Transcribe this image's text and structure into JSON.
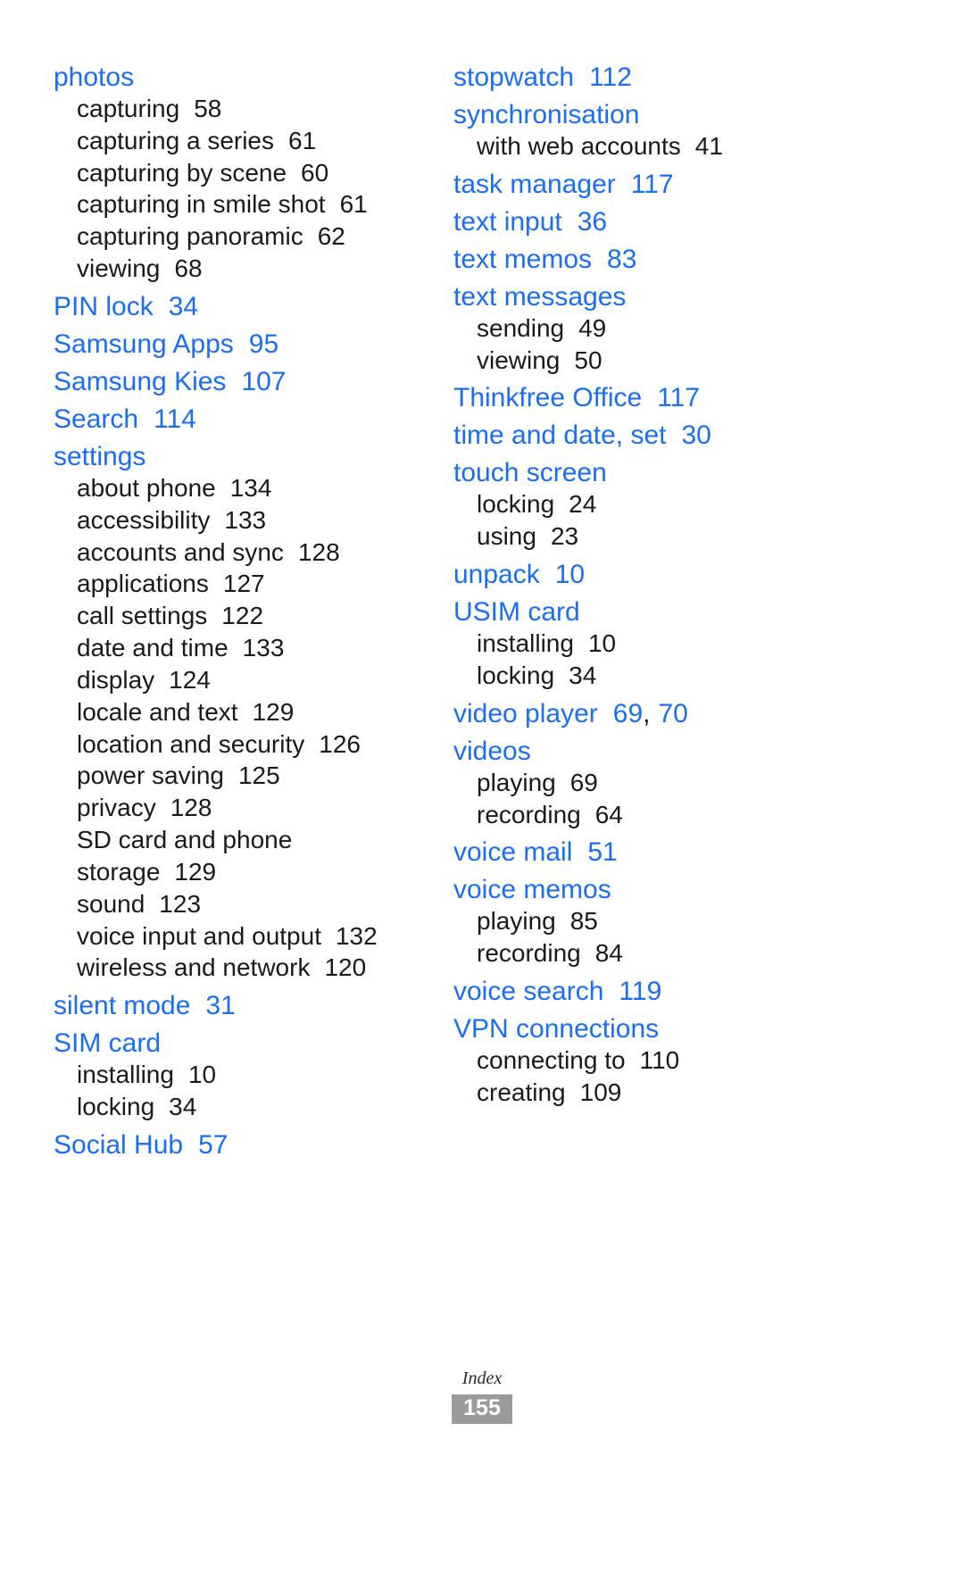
{
  "document": {
    "footer_label": "Index",
    "page_number": "155",
    "accent_color": "#1a6ef5",
    "text_color": "#1a1a1a",
    "badge_color": "#9a9a9a"
  },
  "left_column": [
    {
      "term": "photos",
      "page": "",
      "subs": [
        {
          "label": "capturing",
          "page": "58"
        },
        {
          "label": "capturing a series",
          "page": "61"
        },
        {
          "label": "capturing by scene",
          "page": "60"
        },
        {
          "label": "capturing in smile shot",
          "page": "61"
        },
        {
          "label": "capturing panoramic",
          "page": "62"
        },
        {
          "label": "viewing",
          "page": "68"
        }
      ]
    },
    {
      "term": "PIN lock",
      "page": "34",
      "subs": []
    },
    {
      "term": "Samsung Apps",
      "page": "95",
      "subs": []
    },
    {
      "term": "Samsung Kies",
      "page": "107",
      "subs": []
    },
    {
      "term": "Search",
      "page": "114",
      "subs": []
    },
    {
      "term": "settings",
      "page": "",
      "subs": [
        {
          "label": "about phone",
          "page": "134"
        },
        {
          "label": "accessibility",
          "page": "133"
        },
        {
          "label": "accounts and sync",
          "page": "128"
        },
        {
          "label": "applications",
          "page": "127"
        },
        {
          "label": "call settings",
          "page": "122"
        },
        {
          "label": "date and time",
          "page": "133"
        },
        {
          "label": "display",
          "page": "124"
        },
        {
          "label": "locale and text",
          "page": "129"
        },
        {
          "label": "location and security",
          "page": "126"
        },
        {
          "label": "power saving",
          "page": "125"
        },
        {
          "label": "privacy",
          "page": "128"
        },
        {
          "label": "SD card and phone storage",
          "page": "129",
          "wrap": true
        },
        {
          "label": "sound",
          "page": "123"
        },
        {
          "label": "voice input and output",
          "page": "132"
        },
        {
          "label": "wireless and network",
          "page": "120"
        }
      ]
    },
    {
      "term": "silent mode",
      "page": "31",
      "subs": []
    },
    {
      "term": "SIM card",
      "page": "",
      "subs": [
        {
          "label": "installing",
          "page": "10"
        },
        {
          "label": "locking",
          "page": "34"
        }
      ]
    },
    {
      "term": "Social Hub",
      "page": "57",
      "subs": []
    }
  ],
  "right_column": [
    {
      "term": "stopwatch",
      "page": "112",
      "subs": []
    },
    {
      "term": "synchronisation",
      "page": "",
      "subs": [
        {
          "label": "with web accounts",
          "page": "41"
        }
      ]
    },
    {
      "term": "task manager",
      "page": "117",
      "subs": []
    },
    {
      "term": "text input",
      "page": "36",
      "subs": []
    },
    {
      "term": "text memos",
      "page": "83",
      "subs": []
    },
    {
      "term": "text messages",
      "page": "",
      "subs": [
        {
          "label": "sending",
          "page": "49"
        },
        {
          "label": "viewing",
          "page": "50"
        }
      ]
    },
    {
      "term": "Thinkfree Office",
      "page": "117",
      "subs": []
    },
    {
      "term": "time and date, set",
      "page": "30",
      "subs": []
    },
    {
      "term": "touch screen",
      "page": "",
      "subs": [
        {
          "label": "locking",
          "page": "24"
        },
        {
          "label": "using",
          "page": "23"
        }
      ]
    },
    {
      "term": "unpack",
      "page": "10",
      "subs": []
    },
    {
      "term": "USIM card",
      "page": "",
      "subs": [
        {
          "label": "installing",
          "page": "10"
        },
        {
          "label": "locking",
          "page": "34"
        }
      ]
    },
    {
      "term": "video player",
      "page": "69",
      "page2": "70",
      "separator": ",",
      "subs": []
    },
    {
      "term": "videos",
      "page": "",
      "subs": [
        {
          "label": "playing",
          "page": "69"
        },
        {
          "label": "recording",
          "page": "64"
        }
      ]
    },
    {
      "term": "voice mail",
      "page": "51",
      "subs": []
    },
    {
      "term": "voice memos",
      "page": "",
      "subs": [
        {
          "label": "playing",
          "page": "85"
        },
        {
          "label": "recording",
          "page": "84"
        }
      ]
    },
    {
      "term": "voice search",
      "page": "119",
      "subs": []
    },
    {
      "term": "VPN connections",
      "page": "",
      "subs": [
        {
          "label": "connecting to",
          "page": "110"
        },
        {
          "label": "creating",
          "page": "109"
        }
      ]
    }
  ]
}
